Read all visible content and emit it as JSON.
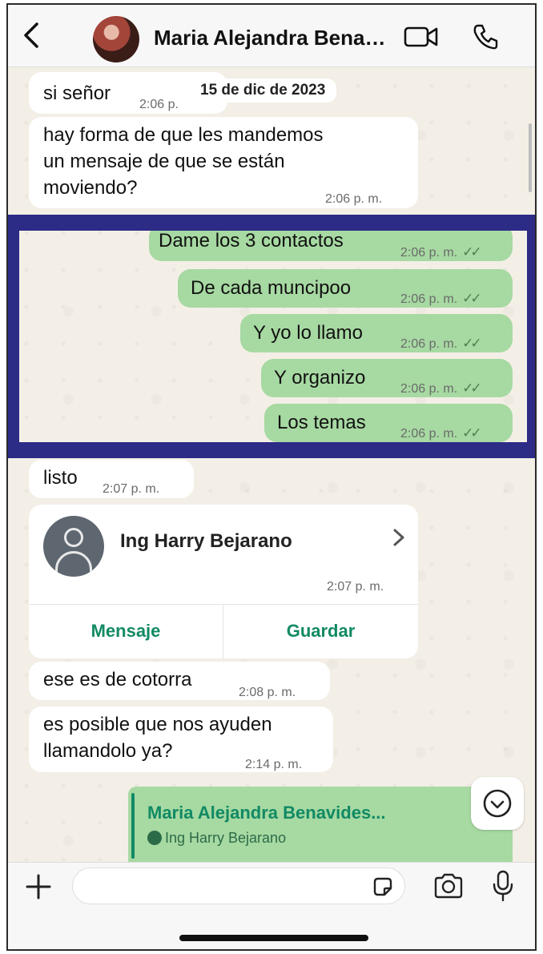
{
  "header": {
    "back_icon": "chevron-left-icon",
    "contact_name": "Maria Alejandra Bena…",
    "video_icon": "video-camera-icon",
    "call_icon": "phone-icon"
  },
  "chat": {
    "date_separator": "15 de dic de 2023",
    "messages": [
      {
        "direction": "in",
        "text": "si señor",
        "time": "2:06 p."
      },
      {
        "direction": "in",
        "text_lines": [
          "hay forma de que les mandemos",
          "un mensaje de que se están",
          "moviendo?"
        ],
        "time": "2:06 p. m."
      },
      {
        "direction": "out",
        "text": "Dame los 3 contactos",
        "time": "2:06 p. m."
      },
      {
        "direction": "out",
        "text": "De cada muncipoo",
        "time": "2:06 p. m."
      },
      {
        "direction": "out",
        "text": "Y yo lo llamo",
        "time": "2:06 p. m."
      },
      {
        "direction": "out",
        "text": "Y organizo",
        "time": "2:06 p. m."
      },
      {
        "direction": "out",
        "text": "Los temas",
        "time": "2:06 p. m."
      },
      {
        "direction": "in",
        "text": "listo",
        "time": "2:07 p. m."
      },
      {
        "direction": "in",
        "text": "ese es de cotorra",
        "time": "2:08 p. m."
      },
      {
        "direction": "in",
        "text_lines": [
          "es posible que nos ayuden",
          "llamandolo ya?"
        ],
        "time": "2:14 p. m."
      }
    ],
    "read_ticks": "✓✓",
    "contact_card": {
      "name": "Ing Harry Bejarano",
      "time": "2:07 p. m.",
      "message_button": "Mensaje",
      "save_button": "Guardar"
    },
    "reply_preview": {
      "title": "Maria Alejandra Benavides...",
      "subtitle": "Ing Harry Bejarano"
    }
  },
  "composer": {
    "placeholder": "",
    "plus_icon": "plus-icon",
    "sticker_icon": "sticker-icon",
    "camera_icon": "camera-icon",
    "mic_icon": "microphone-icon"
  },
  "colors": {
    "highlight_border": "#2c2b85",
    "outgoing_bubble": "#a7d9a2",
    "accent_green": "#118a64",
    "incoming_bubble": "#ffffff"
  }
}
